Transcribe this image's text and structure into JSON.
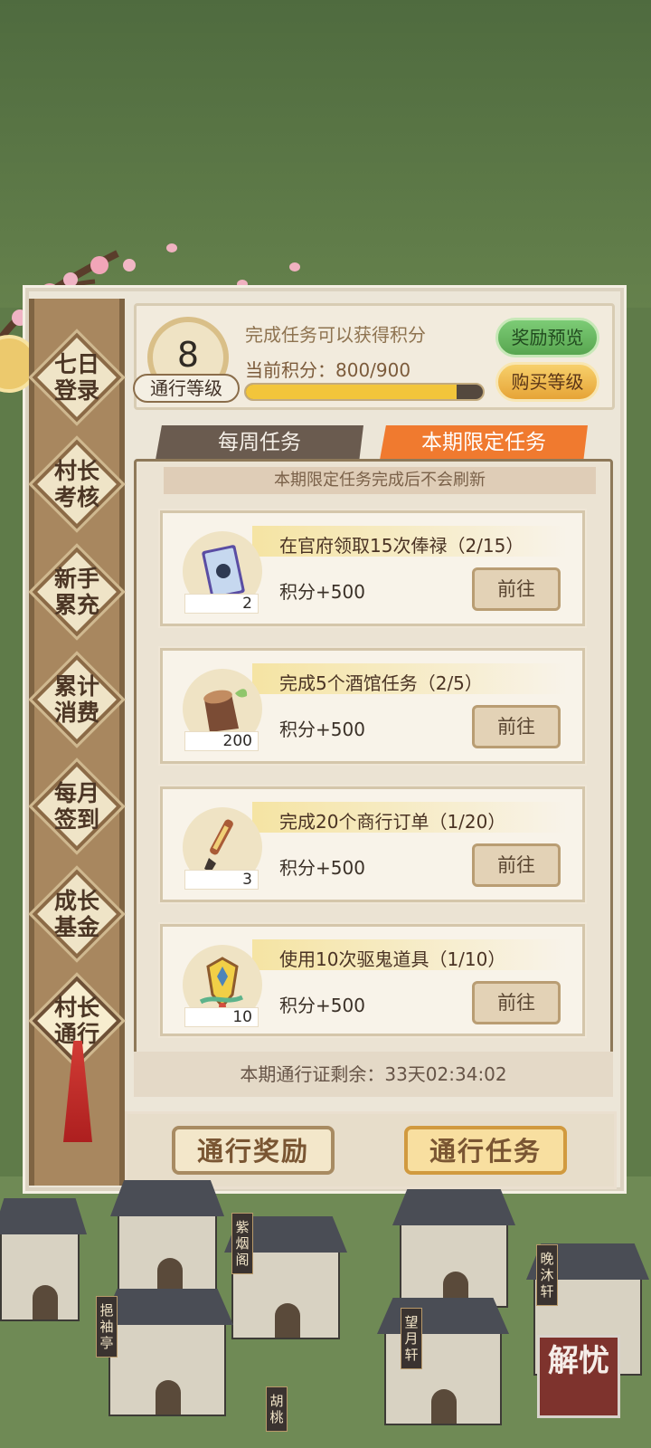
{
  "sidebar": {
    "items": [
      {
        "label": "七日\n登录"
      },
      {
        "label": "村长\n考核"
      },
      {
        "label": "新手\n累充"
      },
      {
        "label": "累计\n消费"
      },
      {
        "label": "每月\n签到"
      },
      {
        "label": "成长\n基金"
      },
      {
        "label": "村长\n通行"
      }
    ]
  },
  "header": {
    "level": "8",
    "level_label": "通行等级",
    "tip": "完成任务可以获得积分",
    "score_label": "当前积分：800/900",
    "progress": 0.889,
    "reward_preview": "奖励预览",
    "buy_level": "购买等级"
  },
  "tabs": [
    {
      "label": "每周任务"
    },
    {
      "label": "本期限定任务"
    }
  ],
  "notice": "本期限定任务完成后不会刷新",
  "tasks": [
    {
      "title": "在官府领取15次俸禄（2/15）",
      "score": "积分+500",
      "count": "2",
      "button": "前往",
      "icon": "scroll-book-icon"
    },
    {
      "title": "完成5个酒馆任务（2/5）",
      "score": "积分+500",
      "count": "200",
      "button": "前往",
      "icon": "wood-stump-icon"
    },
    {
      "title": "完成20个商行订单（1/20）",
      "score": "积分+500",
      "count": "3",
      "button": "前往",
      "icon": "brush-icon"
    },
    {
      "title": "使用10次驱鬼道具（1/10）",
      "score": "积分+500",
      "count": "10",
      "button": "前往",
      "icon": "charm-amulet-icon"
    }
  ],
  "timer": "本期通行证剩余：33天02:34:02",
  "bottom": {
    "left_button": "通行奖励",
    "right_button": "通行任务"
  },
  "town_signs": [
    "紫烟阁",
    "晚沐轩",
    "挹袖亭",
    "望月轩",
    "胡桃"
  ],
  "stamp": "解忧"
}
